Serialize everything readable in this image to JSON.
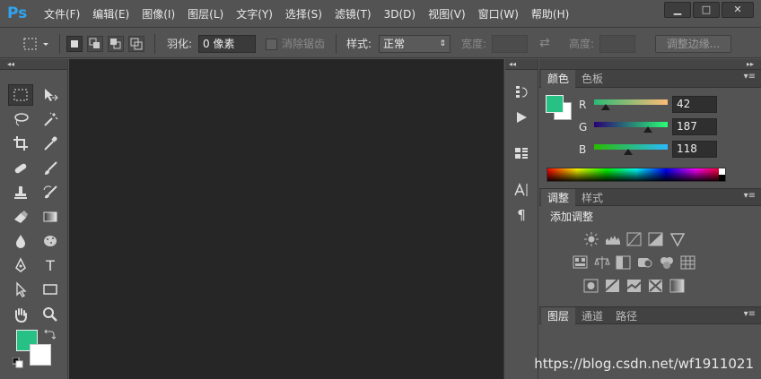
{
  "app": {
    "logo": "Ps"
  },
  "menu": [
    "文件(F)",
    "编辑(E)",
    "图像(I)",
    "图层(L)",
    "文字(Y)",
    "选择(S)",
    "滤镜(T)",
    "3D(D)",
    "视图(V)",
    "窗口(W)",
    "帮助(H)"
  ],
  "window_controls": {
    "minimize": "▁",
    "maximize": "□",
    "close": "✕"
  },
  "options": {
    "feather_label": "羽化:",
    "feather_value": "0 像素",
    "antialias_label": "消除锯齿",
    "style_label": "样式:",
    "style_value": "正常",
    "width_label": "宽度:",
    "height_label": "高度:",
    "refine_edge_label": "调整边缘..."
  },
  "tools": {
    "icons": [
      "rect-marquee-icon",
      "move-icon",
      "lasso-icon",
      "magic-wand-icon",
      "crop-icon",
      "eyedropper-icon",
      "healing-brush-icon",
      "brush-icon",
      "clone-stamp-icon",
      "history-brush-icon",
      "eraser-icon",
      "gradient-icon",
      "blur-icon",
      "sponge-icon",
      "pen-icon",
      "text-icon",
      "path-select-icon",
      "rectangle-icon",
      "hand-icon",
      "zoom-icon"
    ],
    "text_tool_glyph": "T",
    "foreground_color": "#27c085",
    "background_color": "#ffffff"
  },
  "color_panel": {
    "tabs": [
      "颜色",
      "色板"
    ],
    "channels": [
      {
        "label": "R",
        "value": "42"
      },
      {
        "label": "G",
        "value": "187"
      },
      {
        "label": "B",
        "value": "118"
      }
    ],
    "swatch_fg": "#27c085",
    "swatch_bg": "#ffffff"
  },
  "adjustments_panel": {
    "tabs": [
      "调整",
      "样式"
    ],
    "add_label": "添加调整"
  },
  "layers_panel": {
    "tabs": [
      "图层",
      "通道",
      "路径"
    ]
  },
  "watermark": "https://blog.csdn.net/wf1911021"
}
